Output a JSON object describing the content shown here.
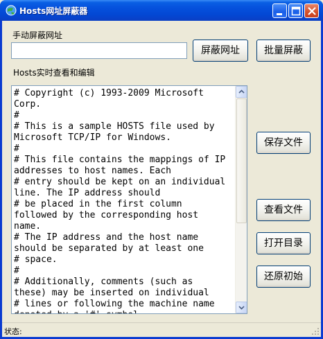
{
  "window": {
    "title": "Hosts网址屏蔽器"
  },
  "manual": {
    "label": "手动屏蔽网址",
    "input_value": "",
    "block_button": "屏蔽网址",
    "batch_button": "批量屏蔽"
  },
  "editor": {
    "label": "Hosts实时查看和编辑",
    "content": "# Copyright (c) 1993-2009 Microsoft\nCorp.\n#\n# This is a sample HOSTS file used by\nMicrosoft TCP/IP for Windows.\n#\n# This file contains the mappings of IP\naddresses to host names. Each\n# entry should be kept on an individual\nline. The IP address should\n# be placed in the first column\nfollowed by the corresponding host\nname.\n# The IP address and the host name\nshould be separated by at least one\n# space.\n#\n# Additionally, comments (such as\nthese) may be inserted on individual\n# lines or following the machine name\ndenoted by a '#' symbol."
  },
  "side_buttons": {
    "save": "保存文件",
    "view": "查看文件",
    "open_dir": "打开目录",
    "restore": "还原初始"
  },
  "statusbar": {
    "label": "状态:"
  },
  "colors": {
    "titlebar": "#0550dc",
    "face": "#ece9d8",
    "button_border": "#003c74"
  }
}
